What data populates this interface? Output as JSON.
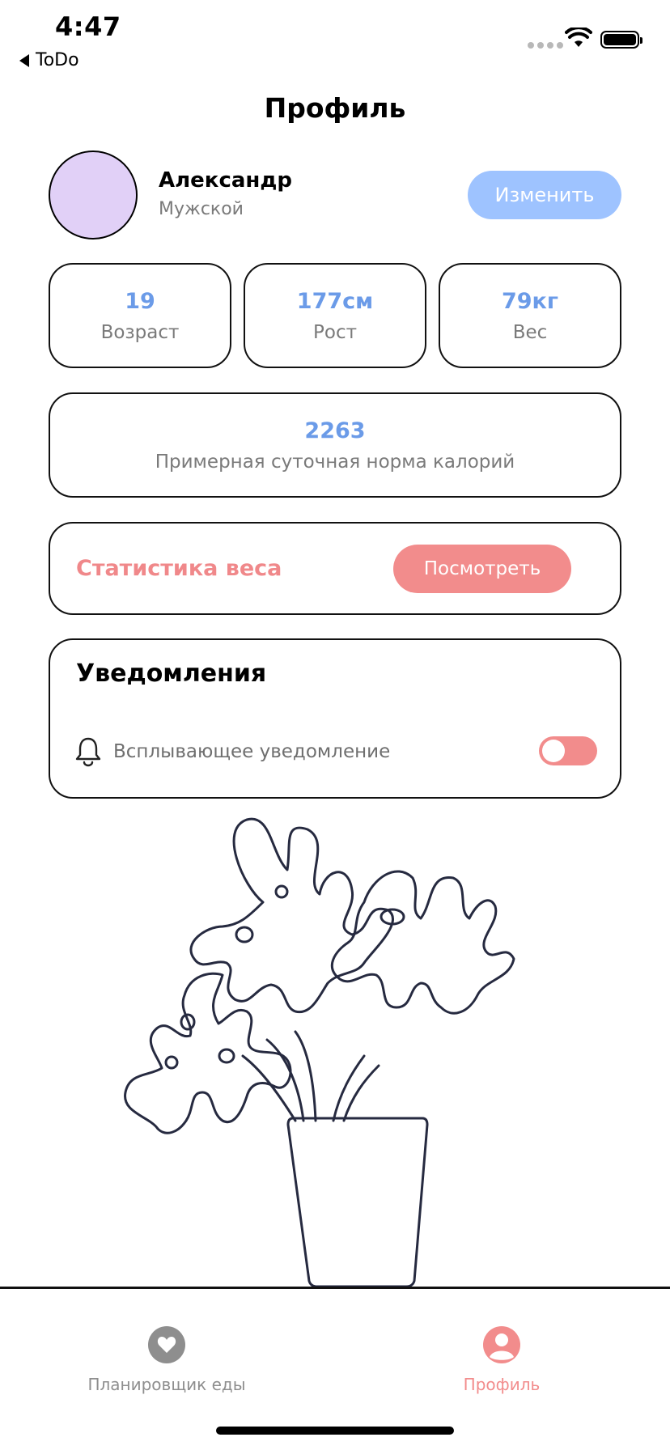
{
  "status_bar": {
    "time": "4:47",
    "back_label": "ToDo"
  },
  "header": {
    "title": "Профиль"
  },
  "profile": {
    "name": "Александр",
    "gender": "Мужской",
    "edit_label": "Изменить",
    "avatar_color": "#e1d0f7"
  },
  "stats": [
    {
      "value": "19",
      "label": "Возраст"
    },
    {
      "value": "177см",
      "label": "Рост"
    },
    {
      "value": "79кг",
      "label": "Вес"
    }
  ],
  "calories": {
    "value": "2263",
    "label": "Примерная суточная норма калорий"
  },
  "weight_stats": {
    "label": "Статистика веса",
    "button_label": "Посмотреть"
  },
  "notifications": {
    "heading": "Уведомления",
    "item_label": "Всплывающее уведомление",
    "toggle_on": false
  },
  "tabs": [
    {
      "label": "Планировщик еды",
      "icon": "heart-icon",
      "active": false
    },
    {
      "label": "Профиль",
      "icon": "person-icon",
      "active": true
    }
  ],
  "colors": {
    "accent_blue": "#6b9be8",
    "accent_pink": "#f28c8c",
    "button_blue": "#9ec3ff"
  }
}
